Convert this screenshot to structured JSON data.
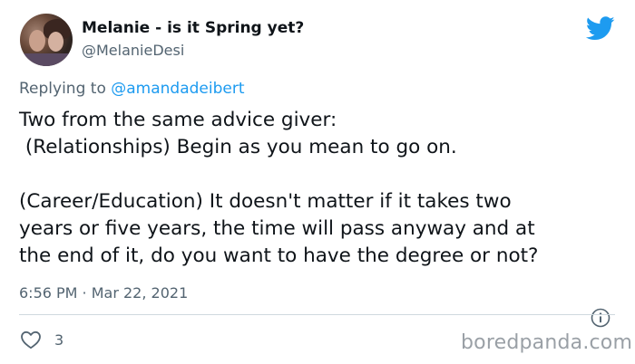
{
  "author": {
    "display_name": "Melanie - is it Spring yet?",
    "handle": "@MelanieDesi"
  },
  "reply": {
    "prefix": "Replying to ",
    "mention": "@amandadeibert"
  },
  "tweet": {
    "lines": [
      "Two from the same advice giver:",
      " (Relationships) Begin as you mean to go on.",
      "",
      "(Career/Education) It doesn't matter if it takes two",
      "years or five years, the time will pass anyway and at",
      "the end of it, do you want to have the degree or not?"
    ],
    "timestamp": "6:56 PM · Mar 22, 2021"
  },
  "actions": {
    "like_count": "3"
  },
  "watermark": "boredpanda.com",
  "colors": {
    "twitter_blue": "#1d9bf0",
    "secondary_text": "#536471",
    "primary_text": "#0f1419",
    "divider": "#cfd9de"
  },
  "icons": {
    "brand": "twitter-bird-icon",
    "info": "info-icon",
    "like": "heart-outline-icon"
  }
}
